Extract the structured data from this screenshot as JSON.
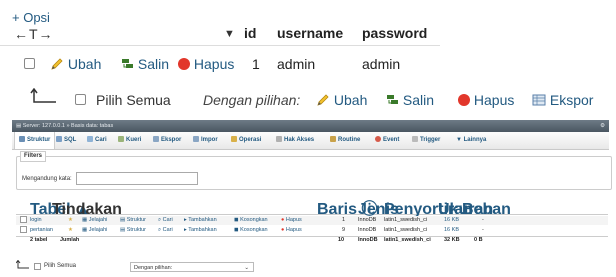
{
  "top": {
    "options_link": "+ Opsi",
    "arrows": "←T→",
    "columns": [
      "id",
      "username",
      "password"
    ],
    "row": {
      "actions": [
        "Ubah",
        "Salin",
        "Hapus"
      ],
      "id": "1",
      "username": "admin",
      "password": "admin"
    },
    "bulk": {
      "check_all": "Pilih Semua",
      "with_selected": "Dengan pilihan:",
      "actions": [
        "Ubah",
        "Salin",
        "Hapus",
        "Ekspor"
      ]
    }
  },
  "bottom": {
    "breadcrumb": "Server: 127.0.0.1 » Basis data: tabas",
    "tabs": [
      "Struktur",
      "SQL",
      "Cari",
      "Kueri",
      "Ekspor",
      "Impor",
      "Operasi",
      "Hak Akses",
      "Routine",
      "Event",
      "Trigger",
      "Lainnya"
    ],
    "filters": {
      "legend": "Filters",
      "label": "Mengandung kata:",
      "value": ""
    },
    "table": {
      "headers": [
        "Tabel",
        "Tindakan",
        "Baris",
        "Jenis",
        "Penyortiran",
        "Ukuran",
        "Beban"
      ],
      "rows": [
        {
          "name": "login",
          "actions": [
            "Jelajahi",
            "Struktur",
            "Cari",
            "Tambahkan",
            "Kosongkan",
            "Hapus"
          ],
          "rows": "1",
          "type": "InnoDB",
          "collation": "latin1_swedish_ci",
          "size": "16 KB",
          "overhead": "-"
        },
        {
          "name": "pertanian",
          "actions": [
            "Jelajahi",
            "Struktur",
            "Cari",
            "Tambahkan",
            "Kosongkan",
            "Hapus"
          ],
          "rows": "9",
          "type": "InnoDB",
          "collation": "latin1_swedish_ci",
          "size": "16 KB",
          "overhead": "-"
        }
      ],
      "summary": {
        "count": "2 tabel",
        "label": "Jumlah",
        "rows": "10",
        "type": "InnoDB",
        "collation": "latin1_swedish_ci",
        "size": "32 KB",
        "overhead": "0 B"
      }
    },
    "bulk": {
      "check_all": "Pilih Semua",
      "with_selected": "Dengan pilihan:"
    }
  },
  "colors": {
    "link": "#235a81",
    "delete": "#e2372b",
    "titlebar": "#4a5661"
  }
}
